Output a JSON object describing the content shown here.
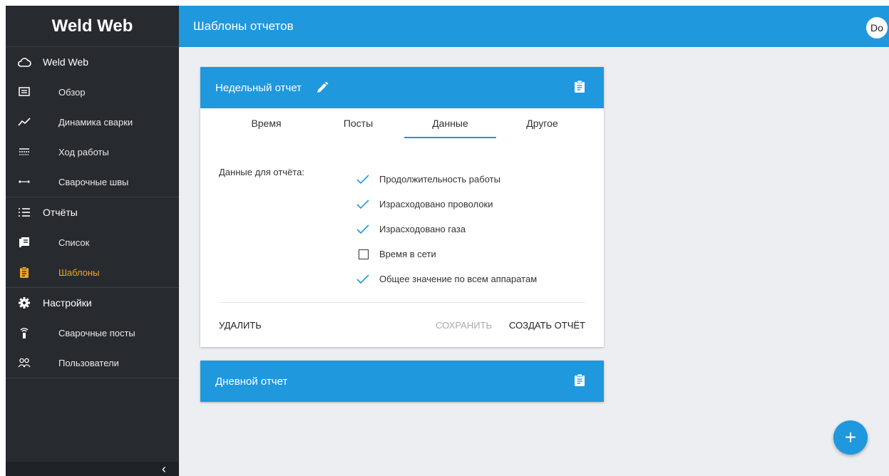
{
  "app": {
    "brand": "Weld Web",
    "page_title": "Шаблоны отчетов",
    "user_avatar": "Do"
  },
  "colors": {
    "accent": "#1f98dd",
    "active_nav": "#f5a623",
    "sidebar_bg": "#272b30"
  },
  "sidebar": {
    "groups": [
      {
        "label": "Weld Web",
        "icon": "cloud-icon",
        "items": [
          {
            "label": "Обзор",
            "icon": "overview-icon"
          },
          {
            "label": "Динамика сварки",
            "icon": "trend-icon"
          },
          {
            "label": "Ход работы",
            "icon": "progress-icon"
          },
          {
            "label": "Сварочные швы",
            "icon": "seam-icon"
          }
        ]
      },
      {
        "label": "Отчёты",
        "icon": "list-icon",
        "items": [
          {
            "label": "Список",
            "icon": "report-list-icon"
          },
          {
            "label": "Шаблоны",
            "icon": "clipboard-icon",
            "active": true
          }
        ]
      },
      {
        "label": "Настройки",
        "icon": "gear-icon",
        "items": [
          {
            "label": "Сварочные посты",
            "icon": "station-icon"
          },
          {
            "label": "Пользователи",
            "icon": "users-icon"
          }
        ]
      }
    ],
    "collapse_label": "‹"
  },
  "cards": [
    {
      "title": "Недельный отчет",
      "tabs": [
        "Время",
        "Посты",
        "Данные",
        "Другое"
      ],
      "active_tab": "Данные",
      "data_label": "Данные для отчёта:",
      "options": [
        {
          "label": "Продолжительность работы",
          "checked": true
        },
        {
          "label": "Израсходовано проволоки",
          "checked": true
        },
        {
          "label": "Израсходовано газа",
          "checked": true
        },
        {
          "label": "Время в сети",
          "checked": false
        },
        {
          "label": "Общее значение по всем аппаратам",
          "checked": true
        }
      ],
      "actions": {
        "delete": "УДАЛИТЬ",
        "save": "СОХРАНИТЬ",
        "create": "СОЗДАТЬ ОТЧЁТ"
      }
    },
    {
      "title": "Дневной отчет"
    }
  ],
  "fab_label": "+"
}
